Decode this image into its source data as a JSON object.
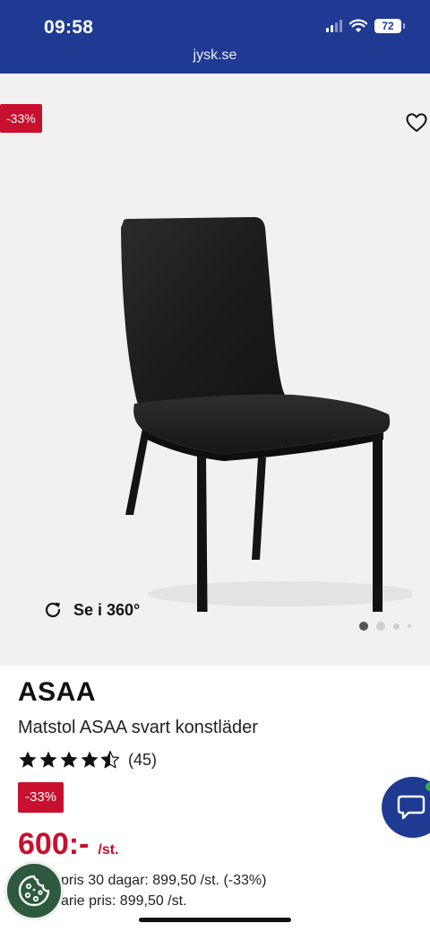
{
  "status_bar": {
    "time": "09:58",
    "battery": "72"
  },
  "browser": {
    "url": "jysk.se"
  },
  "gallery": {
    "discount_badge": "-33%",
    "view_360_label": "Se i 360°",
    "image_count": 4,
    "active_image_index": 0
  },
  "product": {
    "brand": "ASAA",
    "name": "Matstol ASAA svart konstläder",
    "rating": 4.5,
    "review_count": "(45)",
    "discount_badge": "-33%",
    "price": "600:-",
    "price_unit": "/st.",
    "lowest_price_text": "pris 30 dagar: 899,50 /st. (-33%)",
    "ordinary_price_text": "arie pris: 899,50 /st."
  },
  "colors": {
    "header_blue": "#1f3a93",
    "sale_red": "#c8102e",
    "cookie_green": "#2d5a3c",
    "online_green": "#2fb24c"
  },
  "icons": {
    "wishlist": "heart-icon",
    "view_360": "rotate-icon",
    "rating": "star-icon",
    "cookies": "cookie-icon",
    "chat": "chat-bubble-icon"
  }
}
